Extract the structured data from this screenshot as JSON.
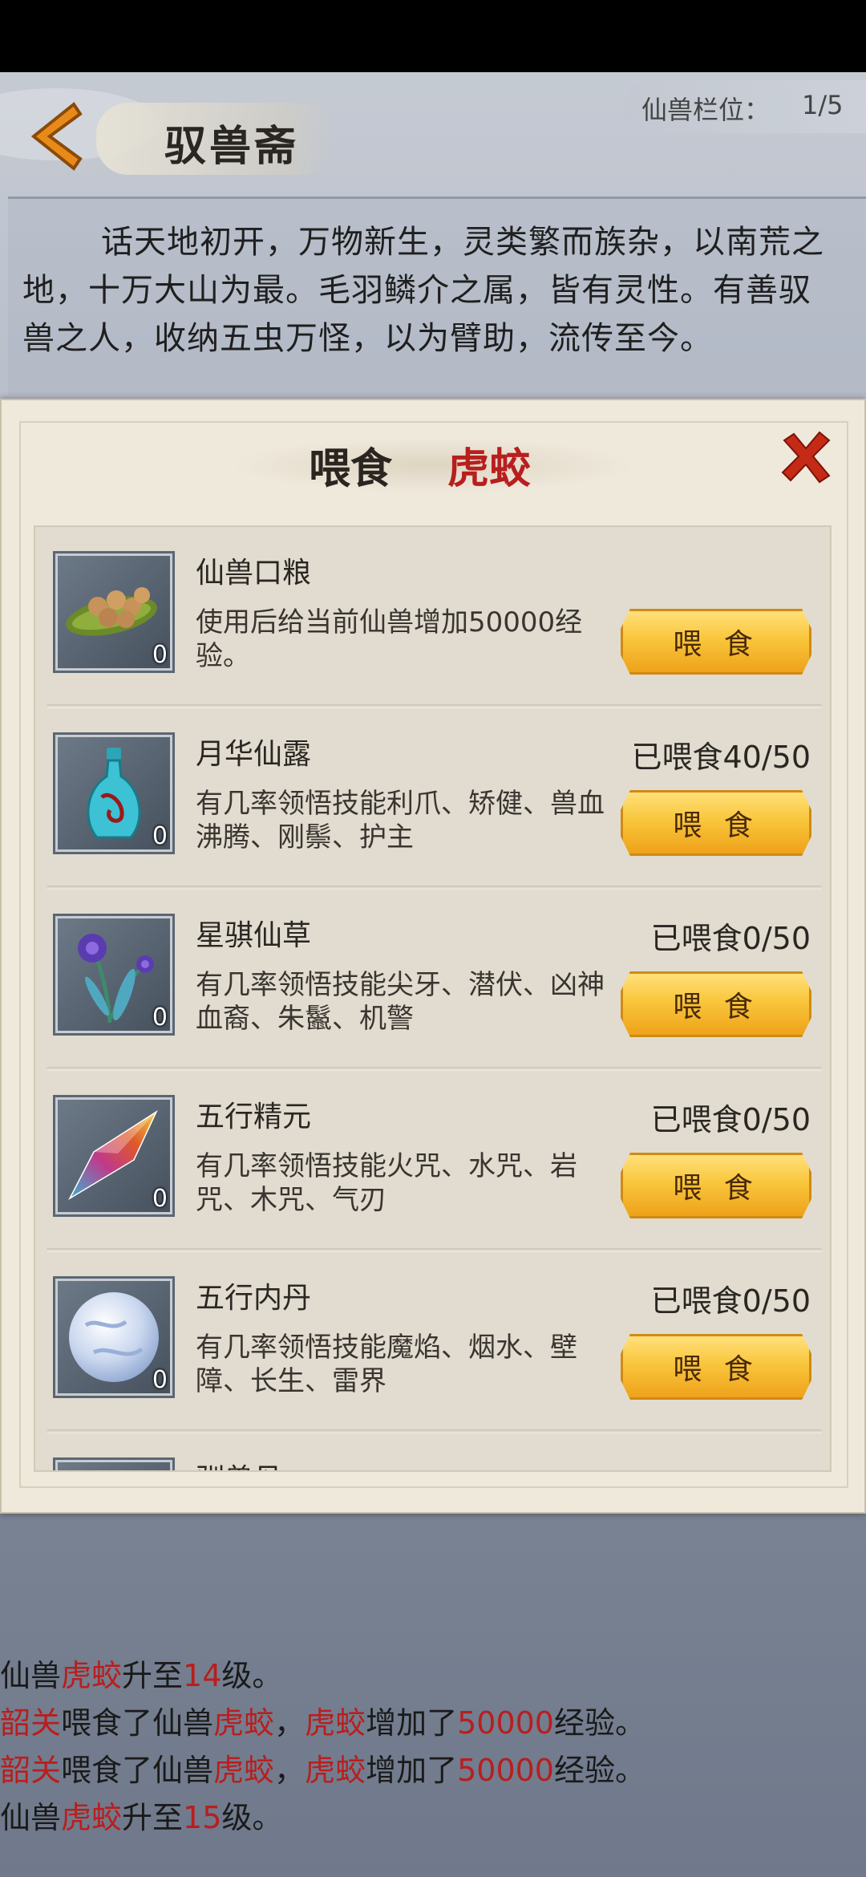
{
  "header": {
    "title": "驭兽斋",
    "slot_label": "仙兽栏位：",
    "slot_value": "1/5"
  },
  "story": {
    "text": "话天地初开，万物新生，灵类繁而族杂，以南荒之地，十万大山为最。毛羽鳞介之属，皆有灵性。有善驭兽之人，收纳五虫万怪，以为臂助，流传至今。"
  },
  "dialog": {
    "title_action": "喂食",
    "title_pet": "虎蛟",
    "close_icon": "close-x-icon",
    "items": [
      {
        "name": "仙兽口粮",
        "desc": "使用后给当前仙兽增加50000经验。",
        "fed": "",
        "count": "0",
        "button": "喂 食",
        "icon": "food-pellets-icon"
      },
      {
        "name": "月华仙露",
        "desc": "有几率领悟技能利爪、矫健、兽血沸腾、刚鬃、护主",
        "fed": "已喂食40/50",
        "count": "0",
        "button": "喂 食",
        "icon": "vase-icon"
      },
      {
        "name": "星骐仙草",
        "desc": "有几率领悟技能尖牙、潜伏、凶神血裔、朱鬣、机警",
        "fed": "已喂食0/50",
        "count": "0",
        "button": "喂 食",
        "icon": "flower-icon"
      },
      {
        "name": "五行精元",
        "desc": "有几率领悟技能火咒、水咒、岩咒、木咒、气刃",
        "fed": "已喂食0/50",
        "count": "0",
        "button": "喂 食",
        "icon": "crystal-icon"
      },
      {
        "name": "五行内丹",
        "desc": "有几率领悟技能魔焰、烟水、壁障、长生、雷界",
        "fed": "已喂食0/50",
        "count": "0",
        "button": "喂 食",
        "icon": "pearl-icon"
      },
      {
        "name": "驯兽丹",
        "desc": "",
        "fed": "",
        "count": "",
        "button": "",
        "icon": "partial-item-icon"
      }
    ]
  },
  "log": [
    [
      {
        "t": "仙兽",
        "h": false
      },
      {
        "t": "虎蛟",
        "h": true
      },
      {
        "t": "升至",
        "h": false
      },
      {
        "t": "14",
        "h": true
      },
      {
        "t": "级。",
        "h": false
      }
    ],
    [
      {
        "t": "韶关",
        "h": true
      },
      {
        "t": "喂食了仙兽",
        "h": false
      },
      {
        "t": "虎蛟",
        "h": true
      },
      {
        "t": "，",
        "h": false
      },
      {
        "t": "虎蛟",
        "h": true
      },
      {
        "t": "增加了",
        "h": false
      },
      {
        "t": "50000",
        "h": true
      },
      {
        "t": "经验。",
        "h": false
      }
    ],
    [
      {
        "t": "韶关",
        "h": true
      },
      {
        "t": "喂食了仙兽",
        "h": false
      },
      {
        "t": "虎蛟",
        "h": true
      },
      {
        "t": "，",
        "h": false
      },
      {
        "t": "虎蛟",
        "h": true
      },
      {
        "t": "增加了",
        "h": false
      },
      {
        "t": "50000",
        "h": true
      },
      {
        "t": "经验。",
        "h": false
      }
    ],
    [
      {
        "t": "仙兽",
        "h": false
      },
      {
        "t": "虎蛟",
        "h": true
      },
      {
        "t": "升至",
        "h": false
      },
      {
        "t": "15",
        "h": true
      },
      {
        "t": "级。",
        "h": false
      }
    ]
  ],
  "colors": {
    "highlight": "#b81e1e",
    "button": "#f9c63c"
  }
}
